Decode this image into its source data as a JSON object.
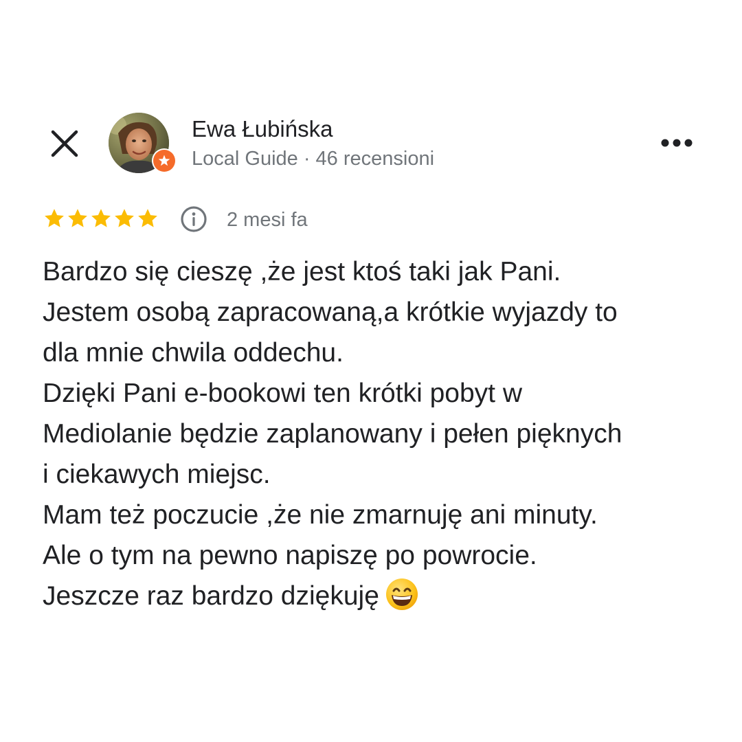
{
  "header": {
    "user_name": "Ewa Łubińska",
    "user_meta": "Local Guide · 46 recensioni",
    "close_icon": "close-icon",
    "more_icon": "more-horizontal-icon"
  },
  "rating": {
    "stars": 5,
    "max_stars": 5,
    "star_color": "#fbbc04",
    "date": "2 mesi fa",
    "info_icon": "info-icon"
  },
  "review": {
    "lines": [
      "Bardzo się cieszę ,że jest ktoś taki jak Pani.",
      "Jestem osobą zapracowaną,a krótkie wyjazdy to",
      "dla mnie chwila oddechu.",
      "Dzięki Pani e-bookowi ten krótki pobyt w",
      "Mediolanie będzie zaplanowany i pełen pięknych",
      "i ciekawych miejsc.",
      "Mam też poczucie ,że nie zmarnuję ani minuty.",
      "Ale o tym na pewno napiszę po powrocie.",
      "Jeszcze raz bardzo dziękuję"
    ],
    "emoji_icon": "grinning-face-emoji-icon"
  },
  "colors": {
    "text": "#202124",
    "secondary_text": "#70757a",
    "badge": "#f56b2a"
  }
}
